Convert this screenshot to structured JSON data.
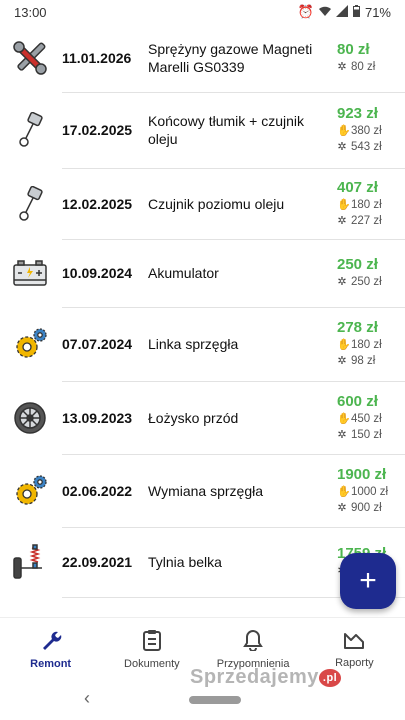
{
  "status": {
    "time": "13:00",
    "battery": "71%"
  },
  "rows": [
    {
      "icon": "wrench-screwdriver-icon",
      "date": "11.01.2026",
      "desc": "Sprężyny gazowe Magneti Marelli GS0339",
      "total": "80 zł",
      "labor": "",
      "parts": "80 zł"
    },
    {
      "icon": "piston-icon",
      "date": "17.02.2025",
      "desc": "Końcowy tłumik + czujnik oleju",
      "total": "923 zł",
      "labor": "380 zł",
      "parts": "543 zł"
    },
    {
      "icon": "piston-icon",
      "date": "12.02.2025",
      "desc": "Czujnik poziomu oleju",
      "total": "407 zł",
      "labor": "180 zł",
      "parts": "227 zł"
    },
    {
      "icon": "battery-icon",
      "date": "10.09.2024",
      "desc": "Akumulator",
      "total": "250 zł",
      "labor": "",
      "parts": "250 zł"
    },
    {
      "icon": "gears-icon",
      "date": "07.07.2024",
      "desc": "Linka sprzęgła",
      "total": "278 zł",
      "labor": "180 zł",
      "parts": "98 zł"
    },
    {
      "icon": "wheel-icon",
      "date": "13.09.2023",
      "desc": "Łożysko przód",
      "total": "600 zł",
      "labor": "450 zł",
      "parts": "150 zł"
    },
    {
      "icon": "gears-icon",
      "date": "02.06.2022",
      "desc": "Wymiana sprzęgła",
      "total": "1900 zł",
      "labor": "1000 zł",
      "parts": "900 zł"
    },
    {
      "icon": "suspension-icon",
      "date": "22.09.2021",
      "desc": "Tylnia belka",
      "total": "1759 zł",
      "labor": "",
      "parts": ""
    }
  ],
  "fab": {
    "label": "+"
  },
  "nav": [
    {
      "label": "Remont",
      "icon": "wrench-icon",
      "active": true
    },
    {
      "label": "Dokumenty",
      "icon": "clipboard-icon",
      "active": false
    },
    {
      "label": "Przypomnienia",
      "icon": "bell-icon",
      "active": false
    },
    {
      "label": "Raporty",
      "icon": "chart-icon",
      "active": false
    }
  ],
  "watermark": {
    "text": "Sprzedajemy",
    "suffix": ".pl"
  },
  "colors": {
    "accent": "#1e2b8f",
    "price": "#4cb54f"
  }
}
